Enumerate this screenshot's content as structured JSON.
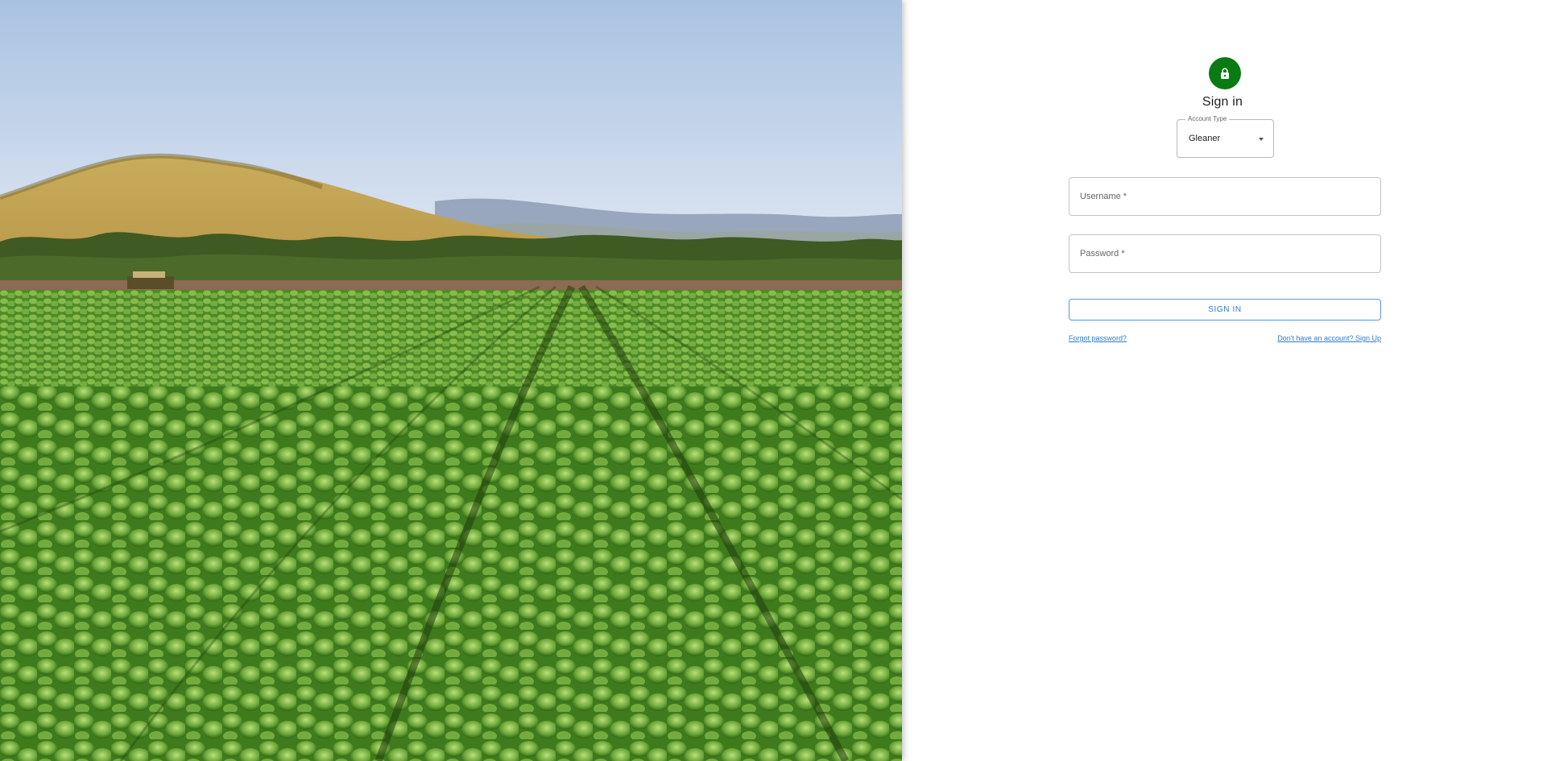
{
  "page": {
    "title": "Sign in"
  },
  "account_type": {
    "label": "Account Type",
    "value": "Gleaner"
  },
  "form": {
    "username_placeholder": "Username *",
    "password_placeholder": "Password *",
    "submit_label": "SIGN IN"
  },
  "links": {
    "forgot": "Forgot password?",
    "signup": "Don't have an account? Sign Up"
  },
  "icons": {
    "avatar": "lock-icon",
    "select": "chevron-down-icon"
  },
  "colors": {
    "accent_green": "#0a7a12",
    "link_blue": "#2e7bd0"
  },
  "hero": {
    "image": "lettuce-field-photo"
  }
}
